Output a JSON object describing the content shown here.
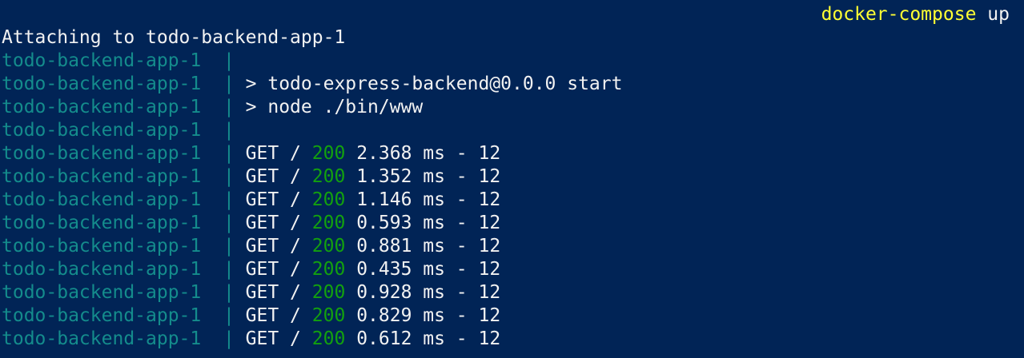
{
  "command": {
    "name": "docker-compose",
    "arg": "up"
  },
  "attach_line": "Attaching to todo-backend-app-1",
  "container": "todo-backend-app-1",
  "separator": "|",
  "log_lines": [
    {
      "text": ""
    },
    {
      "text": "> todo-express-backend@0.0.0 start"
    },
    {
      "text": "> node ./bin/www"
    },
    {
      "text": ""
    },
    {
      "method": "GET /",
      "status": "200",
      "rest": "2.368 ms - 12"
    },
    {
      "method": "GET /",
      "status": "200",
      "rest": "1.352 ms - 12"
    },
    {
      "method": "GET /",
      "status": "200",
      "rest": "1.146 ms - 12"
    },
    {
      "method": "GET /",
      "status": "200",
      "rest": "0.593 ms - 12"
    },
    {
      "method": "GET /",
      "status": "200",
      "rest": "0.881 ms - 12"
    },
    {
      "method": "GET /",
      "status": "200",
      "rest": "0.435 ms - 12"
    },
    {
      "method": "GET /",
      "status": "200",
      "rest": "0.928 ms - 12"
    },
    {
      "method": "GET /",
      "status": "200",
      "rest": "0.829 ms - 12"
    },
    {
      "method": "GET /",
      "status": "200",
      "rest": "0.612 ms - 12"
    }
  ],
  "colors": {
    "background": "#012456",
    "foreground": "#f2f2f2",
    "command": "#ffff33",
    "prefix": "#148c8c",
    "status_ok": "#13a10e"
  }
}
